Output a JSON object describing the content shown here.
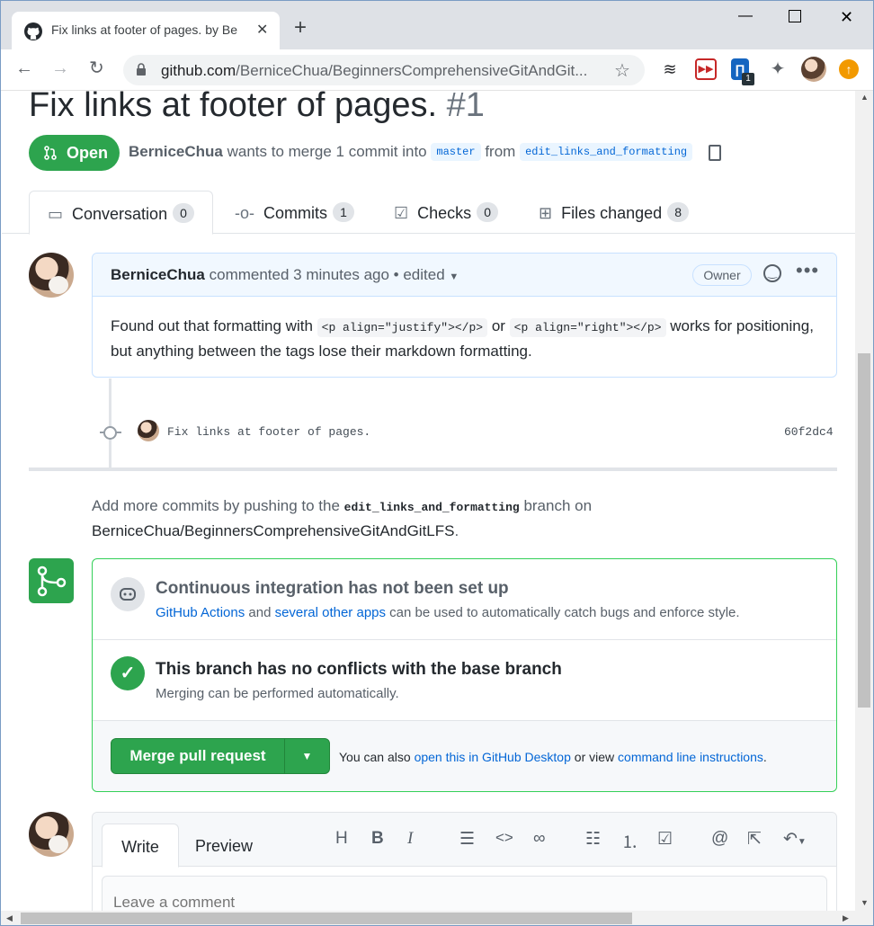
{
  "browser": {
    "tab_title": "Fix links at footer of pages. by Be",
    "url_host": "github.com",
    "url_path": "/BerniceChua/BeginnersComprehensiveGitAndGit..."
  },
  "pr": {
    "title": "Fix links at footer of pages.",
    "number": "#1",
    "state": "Open",
    "author": "BerniceChua",
    "meta_text": "wants to merge 1 commit into",
    "base_branch": "master",
    "from_text": "from",
    "head_branch": "edit_links_and_formatting"
  },
  "tabs": [
    {
      "label": "Conversation",
      "count": "0"
    },
    {
      "label": "Commits",
      "count": "1"
    },
    {
      "label": "Checks",
      "count": "0"
    },
    {
      "label": "Files changed",
      "count": "8"
    }
  ],
  "comment": {
    "author": "BerniceChua",
    "action": "commented 3 minutes ago • edited",
    "badge": "Owner",
    "body_1": "Found out that formatting with",
    "code_1": "<p align=\"justify\"></p>",
    "body_2": "or",
    "code_2": "<p align=\"right\"></p>",
    "body_3": "works for positioning, but anything between the tags lose their markdown formatting."
  },
  "commit": {
    "message": "Fix links at footer of pages.",
    "sha": "60f2dc4"
  },
  "push_note": {
    "text_1": "Add more commits by pushing to the",
    "branch": "edit_links_and_formatting",
    "text_2": "branch on",
    "repo": "BerniceChua/BeginnersComprehensiveGitAndGitLFS",
    "period": "."
  },
  "merge": {
    "ci_title": "Continuous integration has not been set up",
    "ci_link_1": "GitHub Actions",
    "ci_and": "and",
    "ci_link_2": "several other apps",
    "ci_rest": "can be used to automatically catch bugs and enforce style.",
    "conflict_title": "This branch has no conflicts with the base branch",
    "conflict_sub": "Merging can be performed automatically.",
    "button_label": "Merge pull request",
    "also_1": "You can also",
    "also_link_1": "open this in GitHub Desktop",
    "also_2": "or view",
    "also_link_2": "command line instructions",
    "also_3": "."
  },
  "write": {
    "tab_write": "Write",
    "tab_preview": "Preview",
    "placeholder": "Leave a comment"
  },
  "extensions": {
    "badge_count": "1"
  },
  "colors": {
    "open_green": "#2da44e",
    "link_blue": "#0366d6",
    "comment_header": "#f1f8ff"
  }
}
